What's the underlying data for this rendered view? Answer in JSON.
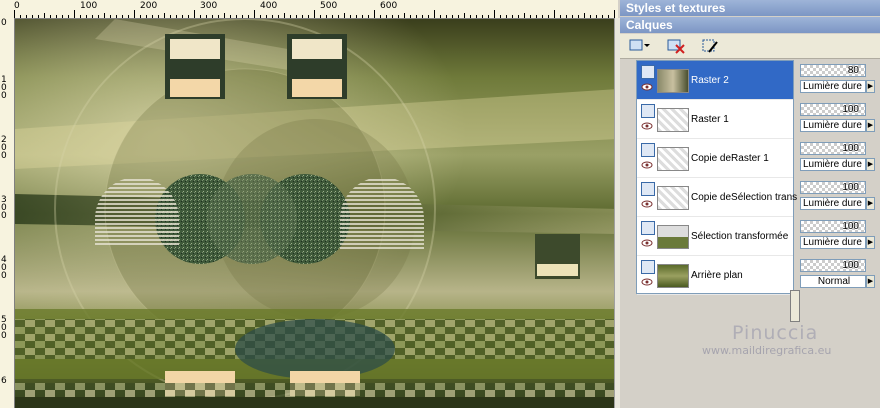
{
  "ruler": {
    "top_labels": [
      "0",
      "100",
      "200",
      "300",
      "400",
      "500",
      "600"
    ],
    "left_labels": [
      "0",
      "1 0 0",
      "2 0 0",
      "3 0 0",
      "4 0 0",
      "5 0 0",
      "6"
    ]
  },
  "panel": {
    "title": "Styles et textures",
    "layers_title": "Calques",
    "layers": [
      {
        "name": "Raster 2",
        "opacity": "80",
        "blend": "Lumière dure",
        "selected": true
      },
      {
        "name": "Raster 1",
        "opacity": "100",
        "blend": "Lumière dure",
        "selected": false
      },
      {
        "name": "Copie deRaster 1",
        "opacity": "100",
        "blend": "Lumière dure",
        "selected": false
      },
      {
        "name": "Copie deSélection trans",
        "opacity": "100",
        "blend": "Lumière dure",
        "selected": false
      },
      {
        "name": "Sélection transformée",
        "opacity": "100",
        "blend": "Lumière dure",
        "selected": false
      },
      {
        "name": "Arrière plan",
        "opacity": "100",
        "blend": "Normal",
        "selected": false
      }
    ]
  },
  "watermark": {
    "name": "Pinuccia",
    "url": "www.maildiregrafica.eu"
  },
  "colors": {
    "selection": "#3169c6",
    "titlebar": "#8aa4d0"
  }
}
